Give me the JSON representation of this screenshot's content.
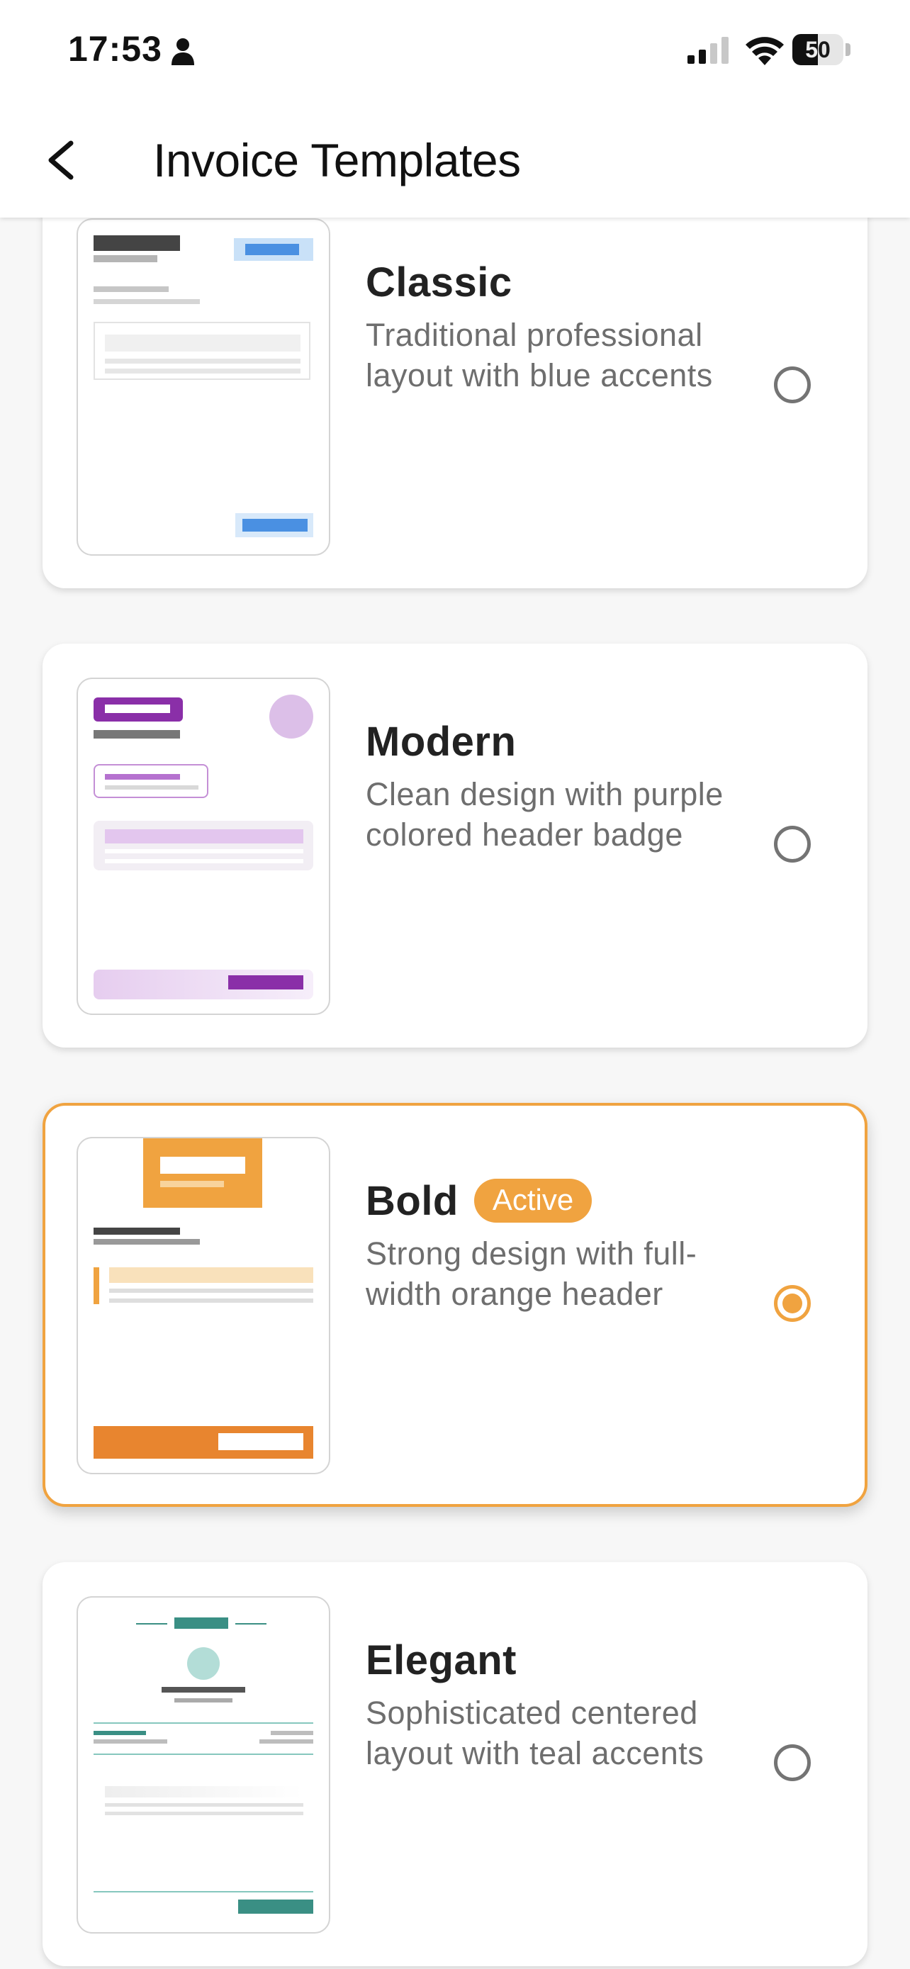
{
  "status_bar": {
    "time": "17:53",
    "battery_level": "50",
    "icons": [
      "person-icon",
      "signal-icon",
      "wifi-icon",
      "battery-icon"
    ]
  },
  "header": {
    "title": "Invoice Templates",
    "back_icon": "chevron-left-icon"
  },
  "colors": {
    "accent_orange": "#f0a340",
    "blue": "#4a90e2",
    "purple": "#8a2fa8",
    "teal": "#3a8f84"
  },
  "templates": [
    {
      "name": "Classic",
      "description": "Traditional professional layout with blue accents",
      "selected": false,
      "badge": ""
    },
    {
      "name": "Modern",
      "description": "Clean design with purple colored header badge",
      "selected": false,
      "badge": ""
    },
    {
      "name": "Bold",
      "description": "Strong design with full-width orange header",
      "selected": true,
      "badge": "Active"
    },
    {
      "name": "Elegant",
      "description": "Sophisticated centered layout with teal accents",
      "selected": false,
      "badge": ""
    }
  ]
}
